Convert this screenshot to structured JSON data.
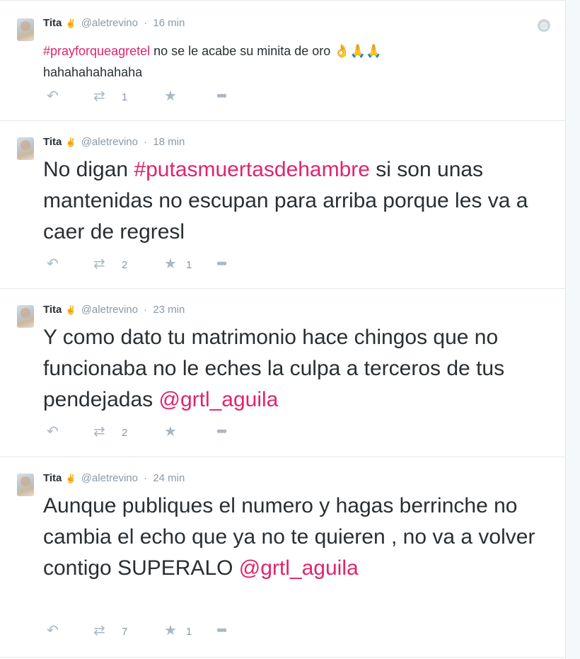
{
  "tweets": [
    {
      "name": "Tita",
      "verified_glyph": "✌",
      "handle": "@aletrevino",
      "dot": "·",
      "time": "16 min",
      "text_parts": [
        "#prayforqueagretel",
        " no se le acabe su minita de oro 👌🙏🙏",
        "hahahahahahaha"
      ],
      "retweets": "1",
      "favorites": ""
    },
    {
      "name": "Tita",
      "verified_glyph": "✌",
      "handle": "@aletrevino",
      "dot": "·",
      "time": "18 min",
      "text_parts": [
        "No digan ",
        "#putasmuertasdehambre",
        " si son unas mantenidas no escupan para arriba porque les va a caer de regresl"
      ],
      "retweets": "2",
      "favorites": "1"
    },
    {
      "name": "Tita",
      "verified_glyph": "✌",
      "handle": "@aletrevino",
      "dot": "·",
      "time": "23 min",
      "text_parts": [
        "Y como dato tu matrimonio hace chingos que no funcionaba no le eches la culpa a terceros de tus pendejadas ",
        "@grtl_aguila"
      ],
      "retweets": "2",
      "favorites": ""
    },
    {
      "name": "Tita",
      "verified_glyph": "✌",
      "handle": "@aletrevino",
      "dot": "·",
      "time": "24 min",
      "text_parts": [
        "Aunque publiques el numero y hagas berrinche no cambia el echo que ya no te quieren , no va a volver contigo SUPERALO ",
        "@grtl_aguila"
      ],
      "retweets": "7",
      "favorites": "1"
    }
  ],
  "icons": {
    "reply": "reply-icon",
    "retweet": "retweet-icon",
    "favorite": "star-icon",
    "more": "more-icon",
    "globe": "globe-icon"
  },
  "colors": {
    "hashtag": "#e0246f",
    "text": "#292f33",
    "meta": "#8899a6",
    "action": "#aab8c2"
  }
}
